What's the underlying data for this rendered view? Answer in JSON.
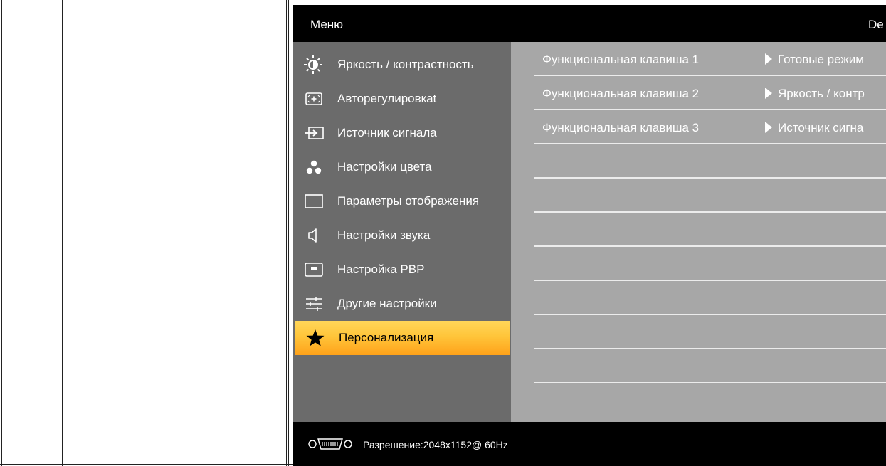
{
  "osd": {
    "title": "Меню",
    "model_partial": "De",
    "menu": [
      {
        "label": "Яркость / контрастность",
        "icon": "brightness-icon"
      },
      {
        "label": "Авторегулировкat",
        "icon": "auto-adjust-icon"
      },
      {
        "label": "Источник сигнала",
        "icon": "input-source-icon"
      },
      {
        "label": "Настройки цвета",
        "icon": "color-settings-icon"
      },
      {
        "label": "Параметры отображения",
        "icon": "display-settings-icon"
      },
      {
        "label": "Настройки звука",
        "icon": "speaker-icon"
      },
      {
        "label": "Настройка PBP",
        "icon": "pbp-icon"
      },
      {
        "label": "Другие настройки",
        "icon": "other-settings-icon"
      },
      {
        "label": "Персонализация",
        "icon": "star-icon",
        "selected": true
      }
    ],
    "rows": [
      {
        "key": "Функциональная клавиша 1",
        "value": "Готовые режим"
      },
      {
        "key": "Функциональная клавиша 2",
        "value": "Яркость / контр"
      },
      {
        "key": "Функциональная клавиша 3",
        "value": "Источник сигна"
      },
      {
        "key": "",
        "value": ""
      },
      {
        "key": "",
        "value": ""
      },
      {
        "key": "",
        "value": ""
      },
      {
        "key": "",
        "value": ""
      },
      {
        "key": "",
        "value": ""
      },
      {
        "key": "",
        "value": ""
      },
      {
        "key": "",
        "value": ""
      }
    ],
    "footer": {
      "resolution": "Разрешение:2048x1152@ 60Hz",
      "connector_icon": "vga-connector-icon"
    },
    "colors": {
      "menu_bg": "#6b6b6b",
      "content_bg": "#a7a7a7",
      "selected_top": "#ffd659",
      "selected_bottom": "#ffa21a"
    }
  }
}
